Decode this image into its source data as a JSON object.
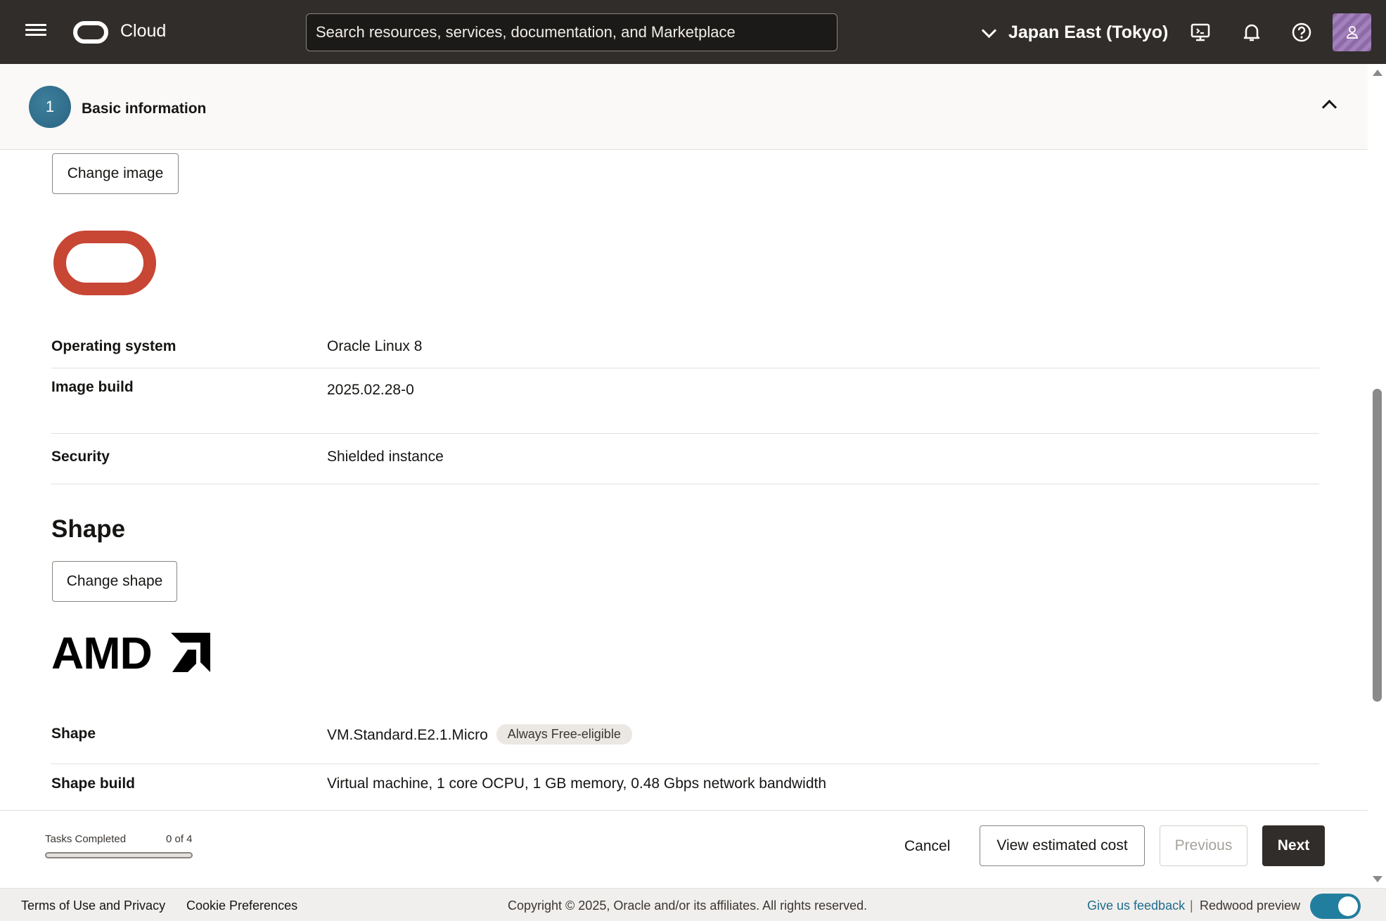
{
  "header": {
    "brand": "Cloud",
    "search_placeholder": "Search resources, services, documentation, and Marketplace",
    "region": "Japan East (Tokyo)"
  },
  "section": {
    "step_number": "1",
    "title": "Basic information"
  },
  "image": {
    "change_button": "Change image",
    "details": [
      {
        "label": "Operating system",
        "value": "Oracle Linux 8"
      },
      {
        "label": "Image build",
        "value": "2025.02.28-0"
      },
      {
        "label": "Security",
        "value": "Shielded instance"
      }
    ]
  },
  "shape": {
    "heading": "Shape",
    "change_button": "Change shape",
    "details": [
      {
        "label": "Shape",
        "value": "VM.Standard.E2.1.Micro",
        "badge": "Always Free-eligible"
      },
      {
        "label": "Shape build",
        "value": "Virtual machine, 1 core OCPU, 1 GB memory, 0.48 Gbps network bandwidth"
      }
    ]
  },
  "action_bar": {
    "tasks_label": "Tasks Completed",
    "tasks_count": "0 of 4",
    "tasks_progress_fraction": 0,
    "cancel": "Cancel",
    "view_cost": "View estimated cost",
    "previous": "Previous",
    "next": "Next"
  },
  "footer": {
    "terms": "Terms of Use and Privacy",
    "cookies": "Cookie Preferences",
    "copyright": "Copyright © 2025, Oracle and/or its affiliates. All rights reserved.",
    "feedback": "Give us feedback",
    "separator": "|",
    "redwood": "Redwood preview",
    "redwood_enabled": true
  },
  "colors": {
    "topbar": "#312d2a",
    "oracle_red": "#c74634",
    "accent": "#227e9e"
  },
  "icons": [
    "hamburger-menu-icon",
    "oracle-logo-icon",
    "chevron-down-icon",
    "cloud-shell-icon",
    "bell-icon",
    "help-icon",
    "user-icon",
    "chevron-up-icon"
  ]
}
